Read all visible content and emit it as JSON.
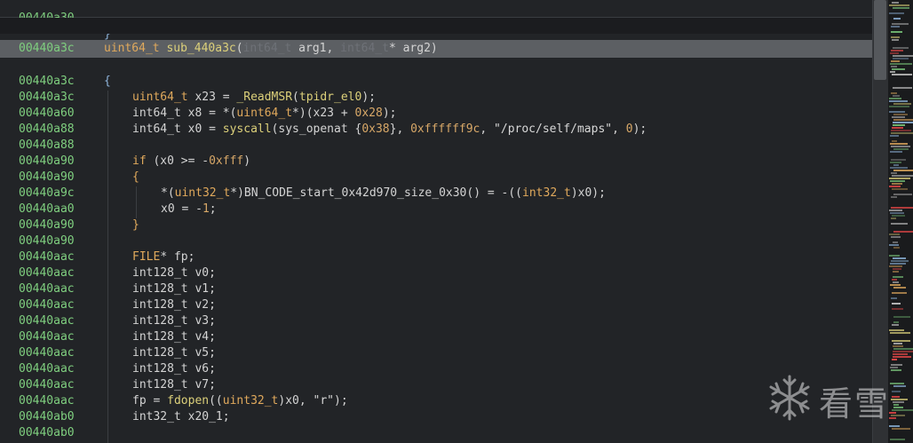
{
  "prev_line": {
    "addr": "00440a30",
    "code": "}"
  },
  "header": {
    "addr": "00440a3c",
    "ret_type": "uint64_t",
    "fn_name": "sub_440a3c",
    "p1_type": "int64_t",
    "p1_name": " arg1, ",
    "p2_type": "int64_t",
    "p2_name": "* arg2)"
  },
  "lines": [
    {
      "addr": "00440a3c",
      "tokens": [
        {
          "t": "{",
          "c": "brace"
        }
      ]
    },
    {
      "addr": "00440a3c",
      "indent": 1,
      "tokens": [
        {
          "t": "uint64_t",
          "c": "kw"
        },
        {
          "t": " x23 = ",
          "c": "plain"
        },
        {
          "t": "_ReadMSR",
          "c": "fn"
        },
        {
          "t": "(",
          "c": "plain"
        },
        {
          "t": "tpidr_el0",
          "c": "fn"
        },
        {
          "t": ");",
          "c": "plain"
        }
      ]
    },
    {
      "addr": "00440a60",
      "indent": 1,
      "tokens": [
        {
          "t": "int64_t",
          "c": "plain"
        },
        {
          "t": " x8 = *(",
          "c": "plain"
        },
        {
          "t": "uint64_t",
          "c": "kw"
        },
        {
          "t": "*)(x23 + ",
          "c": "plain"
        },
        {
          "t": "0x28",
          "c": "num"
        },
        {
          "t": ");",
          "c": "plain"
        }
      ]
    },
    {
      "addr": "00440a88",
      "indent": 1,
      "tokens": [
        {
          "t": "int64_t",
          "c": "plain"
        },
        {
          "t": " x0 = ",
          "c": "plain"
        },
        {
          "t": "syscall",
          "c": "fn"
        },
        {
          "t": "(sys_openat {",
          "c": "plain"
        },
        {
          "t": "0x38",
          "c": "num"
        },
        {
          "t": "}, ",
          "c": "plain"
        },
        {
          "t": "0xffffff9c",
          "c": "num"
        },
        {
          "t": ", ",
          "c": "plain"
        },
        {
          "t": "\"/proc/self/maps\"",
          "c": "str"
        },
        {
          "t": ", ",
          "c": "plain"
        },
        {
          "t": "0",
          "c": "num"
        },
        {
          "t": ");",
          "c": "plain"
        }
      ]
    },
    {
      "addr": "00440a88",
      "tokens": []
    },
    {
      "addr": "00440a90",
      "indent": 1,
      "tokens": [
        {
          "t": "if",
          "c": "kw"
        },
        {
          "t": " (x0 >= -",
          "c": "plain"
        },
        {
          "t": "0xfff",
          "c": "num"
        },
        {
          "t": ")",
          "c": "plain"
        }
      ]
    },
    {
      "addr": "00440a90",
      "indent": 1,
      "tokens": [
        {
          "t": "{",
          "c": "brace2"
        }
      ]
    },
    {
      "addr": "00440a9c",
      "indent": 2,
      "tokens": [
        {
          "t": "*(",
          "c": "plain"
        },
        {
          "t": "uint32_t",
          "c": "kw"
        },
        {
          "t": "*)BN_CODE_start_0x42d970_size_0x30() = -((",
          "c": "plain"
        },
        {
          "t": "int32_t",
          "c": "kw"
        },
        {
          "t": ")x0);",
          "c": "plain"
        }
      ]
    },
    {
      "addr": "00440aa0",
      "indent": 2,
      "tokens": [
        {
          "t": "x0 = -",
          "c": "plain"
        },
        {
          "t": "1",
          "c": "num"
        },
        {
          "t": ";",
          "c": "plain"
        }
      ]
    },
    {
      "addr": "00440a90",
      "indent": 1,
      "tokens": [
        {
          "t": "}",
          "c": "brace2"
        }
      ]
    },
    {
      "addr": "00440a90",
      "tokens": []
    },
    {
      "addr": "00440aac",
      "indent": 1,
      "tokens": [
        {
          "t": "FILE",
          "c": "kw"
        },
        {
          "t": "* fp;",
          "c": "plain"
        }
      ]
    },
    {
      "addr": "00440aac",
      "indent": 1,
      "tokens": [
        {
          "t": "int128_t",
          "c": "plain"
        },
        {
          "t": " v0;",
          "c": "plain"
        }
      ]
    },
    {
      "addr": "00440aac",
      "indent": 1,
      "tokens": [
        {
          "t": "int128_t",
          "c": "plain"
        },
        {
          "t": " v1;",
          "c": "plain"
        }
      ]
    },
    {
      "addr": "00440aac",
      "indent": 1,
      "tokens": [
        {
          "t": "int128_t",
          "c": "plain"
        },
        {
          "t": " v2;",
          "c": "plain"
        }
      ]
    },
    {
      "addr": "00440aac",
      "indent": 1,
      "tokens": [
        {
          "t": "int128_t",
          "c": "plain"
        },
        {
          "t": " v3;",
          "c": "plain"
        }
      ]
    },
    {
      "addr": "00440aac",
      "indent": 1,
      "tokens": [
        {
          "t": "int128_t",
          "c": "plain"
        },
        {
          "t": " v4;",
          "c": "plain"
        }
      ]
    },
    {
      "addr": "00440aac",
      "indent": 1,
      "tokens": [
        {
          "t": "int128_t",
          "c": "plain"
        },
        {
          "t": " v5;",
          "c": "plain"
        }
      ]
    },
    {
      "addr": "00440aac",
      "indent": 1,
      "tokens": [
        {
          "t": "int128_t",
          "c": "plain"
        },
        {
          "t": " v6;",
          "c": "plain"
        }
      ]
    },
    {
      "addr": "00440aac",
      "indent": 1,
      "tokens": [
        {
          "t": "int128_t",
          "c": "plain"
        },
        {
          "t": " v7;",
          "c": "plain"
        }
      ]
    },
    {
      "addr": "00440aac",
      "indent": 1,
      "tokens": [
        {
          "t": "fp = ",
          "c": "plain"
        },
        {
          "t": "fdopen",
          "c": "fn"
        },
        {
          "t": "((",
          "c": "plain"
        },
        {
          "t": "uint32_t",
          "c": "kw"
        },
        {
          "t": ")x0, ",
          "c": "plain"
        },
        {
          "t": "\"r\"",
          "c": "str"
        },
        {
          "t": ");",
          "c": "plain"
        }
      ]
    },
    {
      "addr": "00440ab0",
      "indent": 1,
      "tokens": [
        {
          "t": "int32_t",
          "c": "plain"
        },
        {
          "t": " x20_1;",
          "c": "plain"
        }
      ]
    },
    {
      "addr": "00440ab0",
      "tokens": []
    }
  ],
  "watermark": {
    "text": "看雪",
    "icon": "snowflake-logo-icon"
  },
  "colors": {
    "address": "#7fcf7f",
    "keyword": "#e0a95c",
    "function": "#dcd07a",
    "background": "#222427",
    "highlight_row": "#5c5f63"
  }
}
